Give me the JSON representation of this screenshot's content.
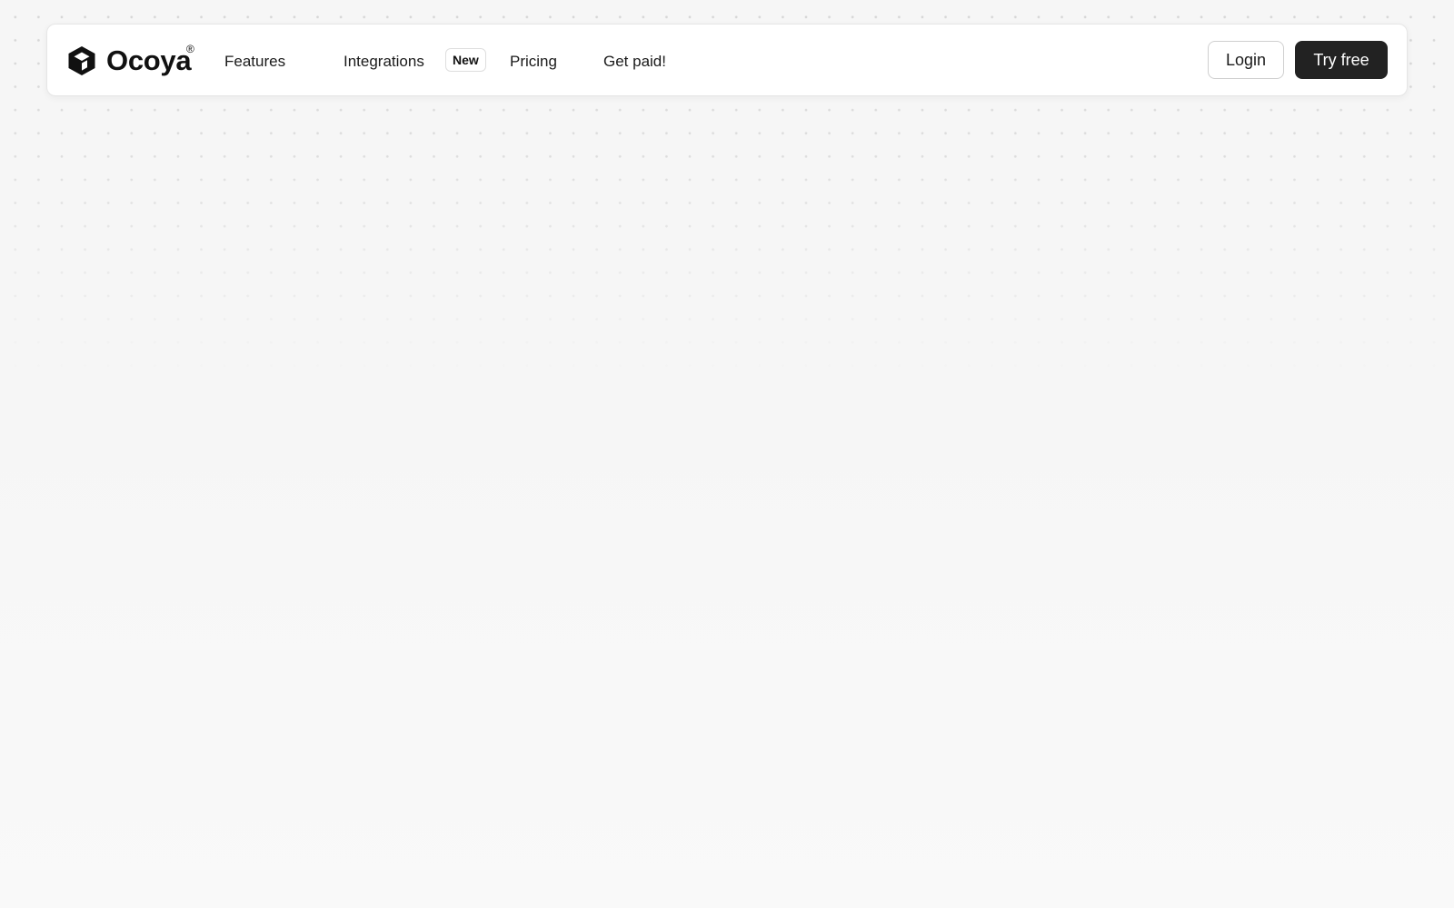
{
  "brand": {
    "name": "Ocoya",
    "trademark": "®",
    "icon": "cube-icon"
  },
  "nav": {
    "links": [
      {
        "label": "Features"
      },
      {
        "label": "Integrations",
        "badge": "New"
      },
      {
        "label": "Pricing"
      },
      {
        "label": "Get paid!"
      }
    ]
  },
  "actions": {
    "login_label": "Login",
    "try_label": "Try free"
  },
  "colors": {
    "page_background": "#f6f6f6",
    "navbar_background": "#ffffff",
    "primary_button": "#222222",
    "text": "#1a1a1a"
  }
}
